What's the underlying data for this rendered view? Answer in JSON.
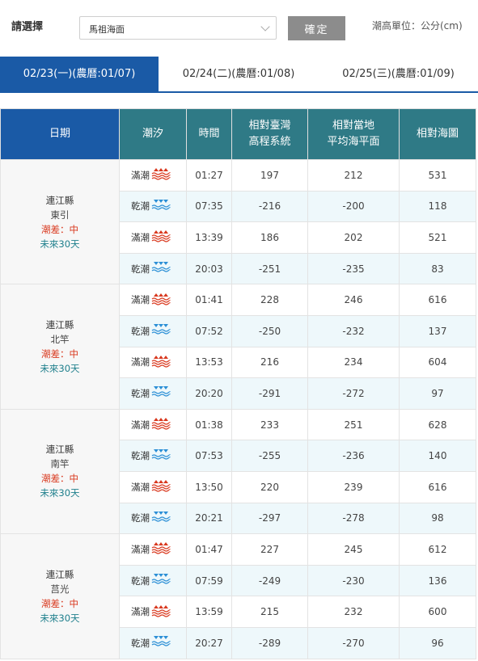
{
  "header": {
    "select_label": "請選擇",
    "select_value": "馬祖海面",
    "confirm_label": "確定",
    "unit_label": "潮高單位：公分(cm)"
  },
  "tabs": [
    {
      "label": "02/23(一)(農曆:01/07)",
      "active": true
    },
    {
      "label": "02/24(二)(農曆:01/08)",
      "active": false
    },
    {
      "label": "02/25(三)(農曆:01/09)",
      "active": false
    }
  ],
  "columns": [
    "日期",
    "潮汐",
    "時間",
    "相對臺灣\n高程系統",
    "相對當地\n平均海平面",
    "相對海圖"
  ],
  "colors": {
    "primary": "#1a5aa6",
    "teal": "#2f7a86",
    "high_tide": "#d9381e",
    "low_tide": "#2b8fd6"
  },
  "locations": [
    {
      "county": "連江縣",
      "name": "東引",
      "diff": "潮差：中",
      "future": "未來30天",
      "rows": [
        {
          "tide": "滿潮",
          "type": "high",
          "time": "01:27",
          "tw": "197",
          "local": "212",
          "chart": "531"
        },
        {
          "tide": "乾潮",
          "type": "low",
          "time": "07:35",
          "tw": "-216",
          "local": "-200",
          "chart": "118"
        },
        {
          "tide": "滿潮",
          "type": "high",
          "time": "13:39",
          "tw": "186",
          "local": "202",
          "chart": "521"
        },
        {
          "tide": "乾潮",
          "type": "low",
          "time": "20:03",
          "tw": "-251",
          "local": "-235",
          "chart": "83"
        }
      ]
    },
    {
      "county": "連江縣",
      "name": "北竿",
      "diff": "潮差：中",
      "future": "未來30天",
      "rows": [
        {
          "tide": "滿潮",
          "type": "high",
          "time": "01:41",
          "tw": "228",
          "local": "246",
          "chart": "616"
        },
        {
          "tide": "乾潮",
          "type": "low",
          "time": "07:52",
          "tw": "-250",
          "local": "-232",
          "chart": "137"
        },
        {
          "tide": "滿潮",
          "type": "high",
          "time": "13:53",
          "tw": "216",
          "local": "234",
          "chart": "604"
        },
        {
          "tide": "乾潮",
          "type": "low",
          "time": "20:20",
          "tw": "-291",
          "local": "-272",
          "chart": "97"
        }
      ]
    },
    {
      "county": "連江縣",
      "name": "南竿",
      "diff": "潮差：中",
      "future": "未來30天",
      "rows": [
        {
          "tide": "滿潮",
          "type": "high",
          "time": "01:38",
          "tw": "233",
          "local": "251",
          "chart": "628"
        },
        {
          "tide": "乾潮",
          "type": "low",
          "time": "07:53",
          "tw": "-255",
          "local": "-236",
          "chart": "140"
        },
        {
          "tide": "滿潮",
          "type": "high",
          "time": "13:50",
          "tw": "220",
          "local": "239",
          "chart": "616"
        },
        {
          "tide": "乾潮",
          "type": "low",
          "time": "20:21",
          "tw": "-297",
          "local": "-278",
          "chart": "98"
        }
      ]
    },
    {
      "county": "連江縣",
      "name": "莒光",
      "diff": "潮差：中",
      "future": "未來30天",
      "rows": [
        {
          "tide": "滿潮",
          "type": "high",
          "time": "01:47",
          "tw": "227",
          "local": "245",
          "chart": "612"
        },
        {
          "tide": "乾潮",
          "type": "low",
          "time": "07:59",
          "tw": "-249",
          "local": "-230",
          "chart": "136"
        },
        {
          "tide": "滿潮",
          "type": "high",
          "time": "13:59",
          "tw": "215",
          "local": "232",
          "chart": "600"
        },
        {
          "tide": "乾潮",
          "type": "low",
          "time": "20:27",
          "tw": "-289",
          "local": "-270",
          "chart": "96"
        }
      ]
    }
  ]
}
